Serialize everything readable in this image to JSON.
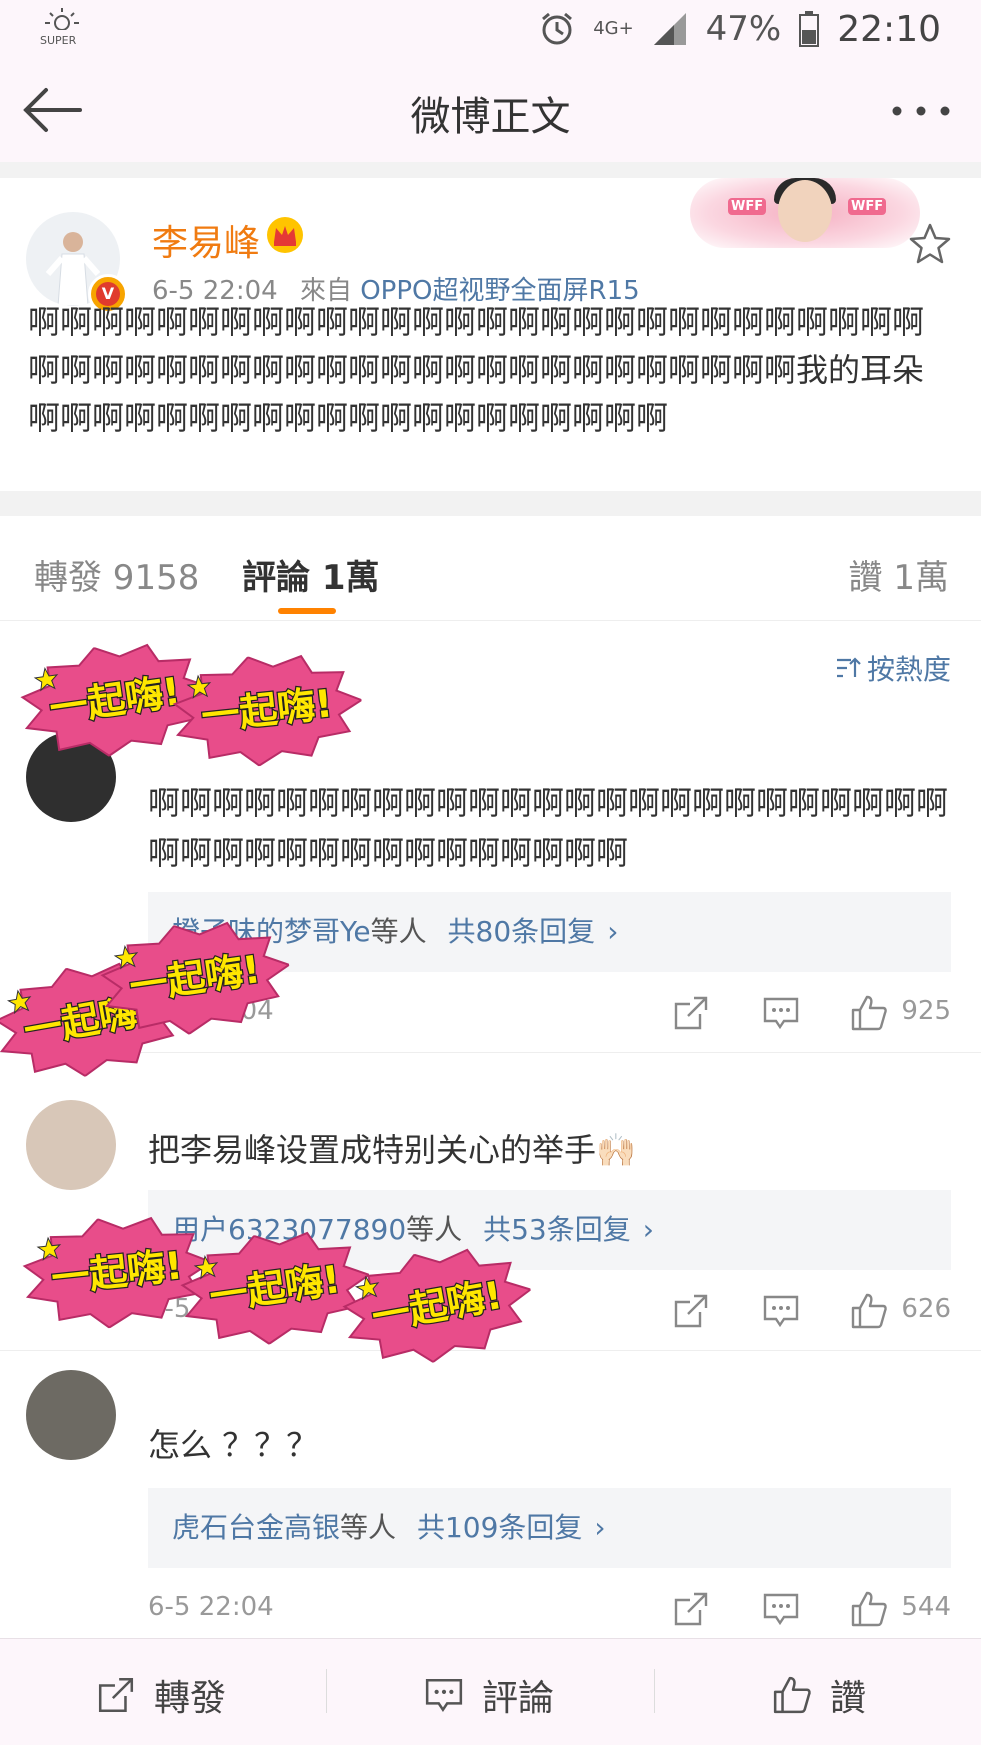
{
  "status_bar": {
    "left_icon": "super-sun-icon",
    "super_label": "SUPER",
    "network": "4G+",
    "battery_pct": "47%",
    "time": "22:10"
  },
  "navbar": {
    "title": "微博正文",
    "back_icon": "back-arrow-icon",
    "more_icon": "more-dots-icon"
  },
  "post": {
    "username": "李易峰",
    "time": "6-5 22:04",
    "from_label": "來自",
    "source": "OPPO超视野全面屏R15",
    "text": "啊啊啊啊啊啊啊啊啊啊啊啊啊啊啊啊啊啊啊啊啊啊啊啊啊啊啊啊啊啊啊啊啊啊啊啊啊啊啊啊啊啊啊啊啊啊啊啊啊啊啊啊我的耳朵啊啊啊啊啊啊啊啊啊啊啊啊啊啊啊啊啊啊啊啊",
    "deco_tag": "WFF"
  },
  "tabs": {
    "repost": "轉發 9158",
    "comments": "評論 1萬",
    "likes": "讚 1萬"
  },
  "sort_label": "按熱度",
  "comments": [
    {
      "text": "啊啊啊啊啊啊啊啊啊啊啊啊啊啊啊啊啊啊啊啊啊啊啊啊啊啊啊啊啊啊啊啊啊啊啊啊啊啊啊啊",
      "reply_who": "橙子味的梦哥Ye",
      "reply_mid": "等人",
      "reply_count": "共80条回复",
      "time": "6-5 22:04",
      "likes": "925"
    },
    {
      "text": "把李易峰设置成特别关心的举手🙌🏻",
      "reply_who": "用户6323077890",
      "reply_mid": "等人",
      "reply_count": "共53条回复",
      "time": "6-5 22:04",
      "likes": "626"
    },
    {
      "text": "怎么 ？？？",
      "reply_who": "虎石台金高银",
      "reply_mid": "等人",
      "reply_count": "共109条回复",
      "time": "6-5 22:04",
      "likes": "544"
    }
  ],
  "sticker_text": "一起嗨!",
  "bottom_bar": {
    "repost": "轉發",
    "comment": "評論",
    "like": "讚"
  },
  "colors": {
    "orange": "#ff8200",
    "link_blue": "#4f78a5",
    "sticker_pink": "#e84d8a",
    "sticker_yellow": "#ffe600"
  }
}
